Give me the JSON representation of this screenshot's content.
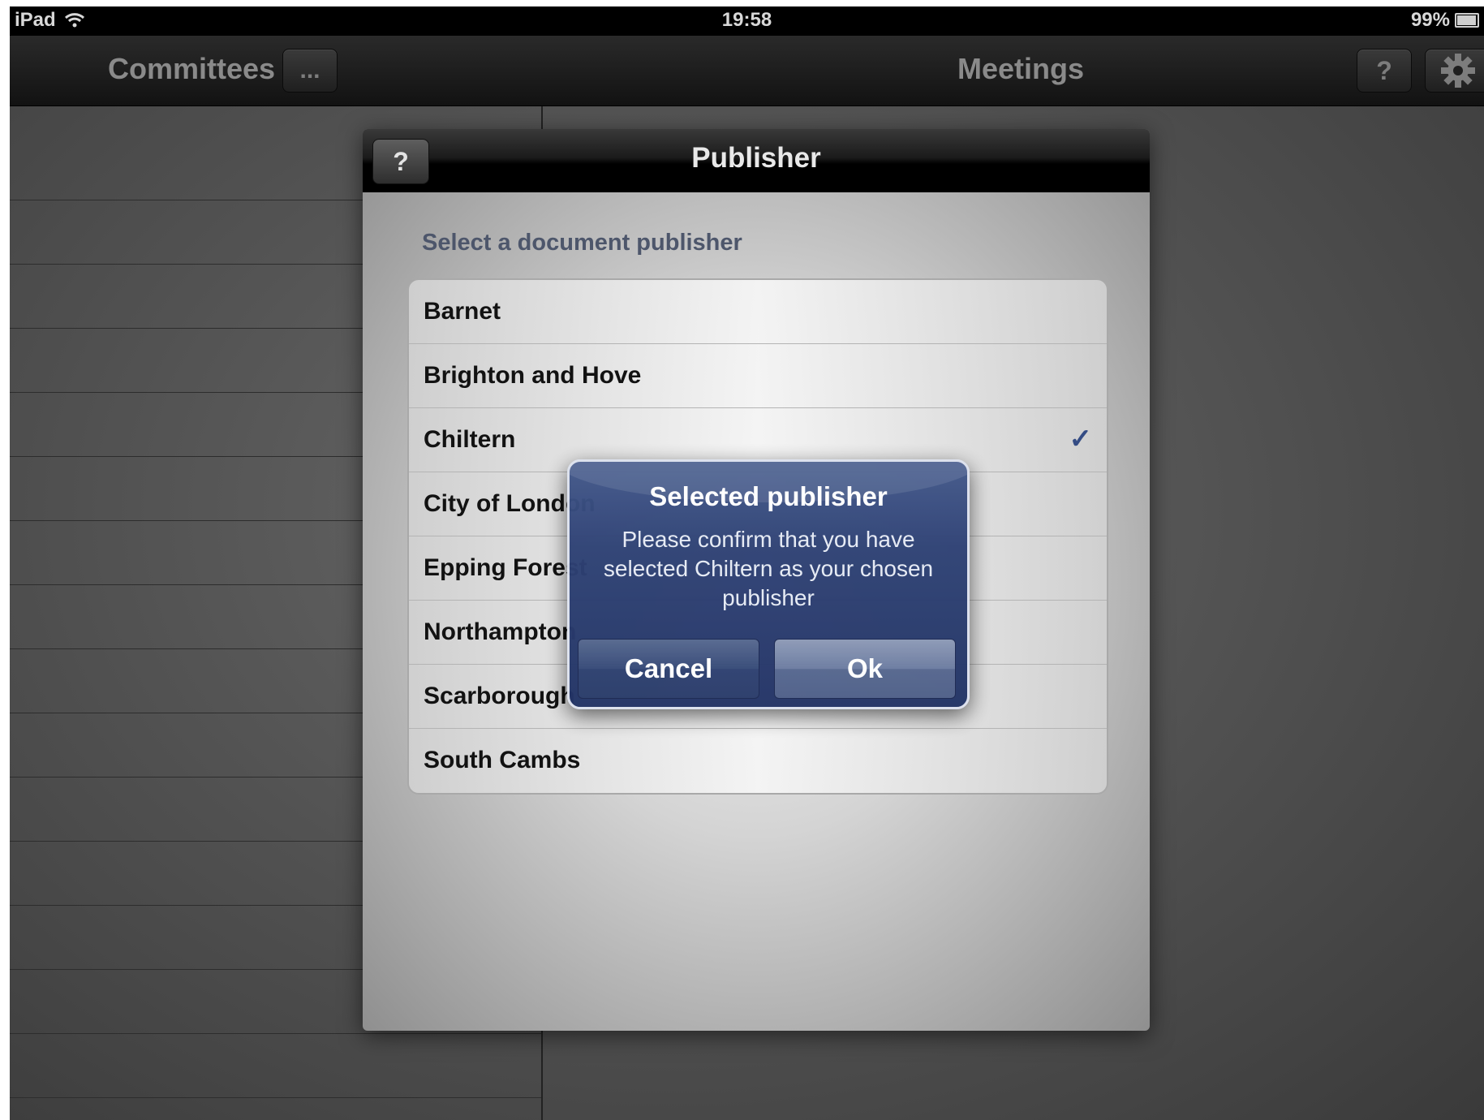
{
  "status_bar": {
    "device": "iPad",
    "time": "19:58",
    "battery": "99%"
  },
  "nav": {
    "left_title": "Committees",
    "more_label": "...",
    "right_title": "Meetings",
    "help_label": "?",
    "settings_icon": "gear-icon"
  },
  "popover": {
    "title": "Publisher",
    "help_label": "?",
    "section_header": "Select a document publisher",
    "publishers": [
      {
        "label": "Barnet"
      },
      {
        "label": "Brighton and Hove"
      },
      {
        "label": "Chiltern",
        "checked": true
      },
      {
        "label": "City of London"
      },
      {
        "label": "Epping Forest"
      },
      {
        "label": "Northampton"
      },
      {
        "label": "Scarborough"
      },
      {
        "label": "South Cambs"
      }
    ]
  },
  "alert": {
    "title": "Selected publisher",
    "message": "Please confirm that you have selected Chiltern as your chosen publisher",
    "cancel_label": "Cancel",
    "ok_label": "Ok"
  }
}
